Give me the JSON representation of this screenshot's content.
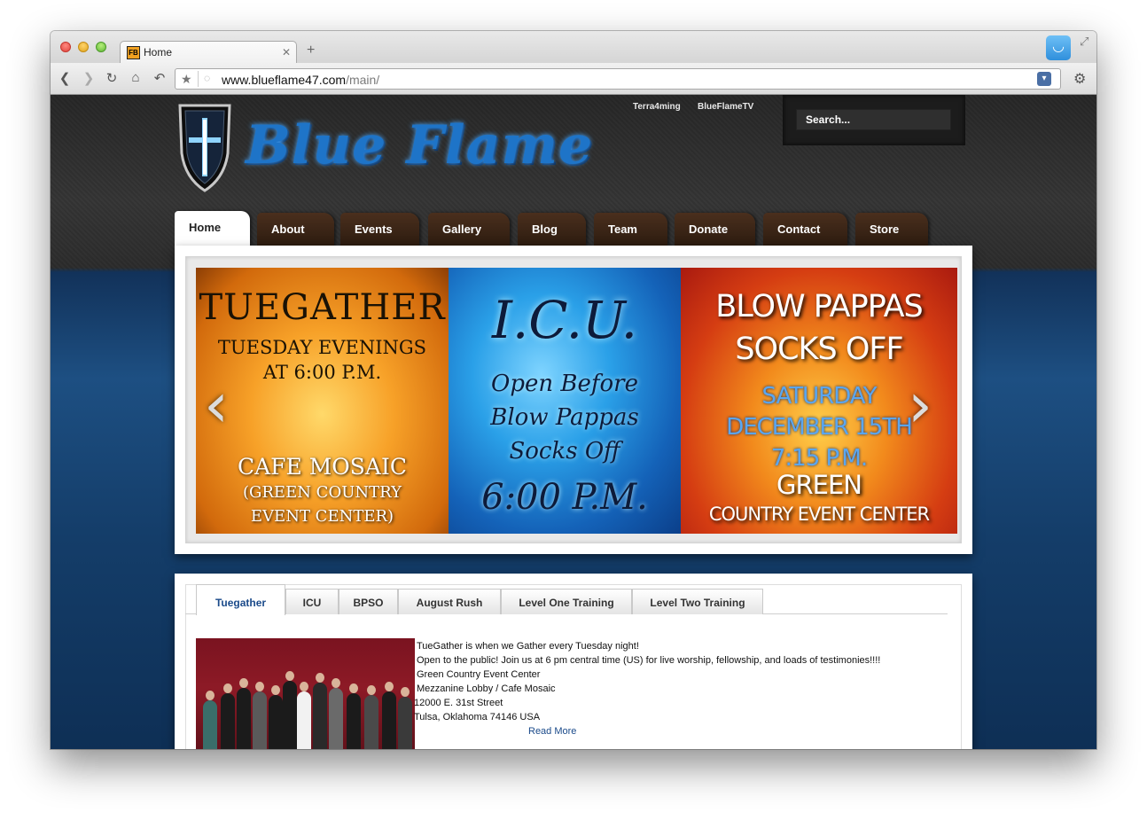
{
  "browser": {
    "tab_title": "Home",
    "tab_favicon": "FB",
    "url_host": "www.blueflame47.com",
    "url_path": "/main/",
    "icons": [
      "back-icon",
      "forward-icon",
      "reload-icon",
      "home-icon",
      "undo-icon",
      "star-icon",
      "wrench-icon"
    ]
  },
  "header": {
    "logo_text": "Blue Flame",
    "top_links": [
      "Terra4ming",
      "BlueFlameTV"
    ],
    "search_placeholder": "Search..."
  },
  "nav": {
    "items": [
      "Home",
      "About",
      "Events",
      "Gallery",
      "Blog",
      "Team",
      "Donate",
      "Contact",
      "Store"
    ],
    "active": "Home"
  },
  "slider": {
    "slide1": {
      "title": "Tuegather",
      "line1": "Tuesday evenings",
      "line2": "at 6:00 P.M.",
      "venue1": "Cafe Mosaic",
      "venue2": "(Green Country",
      "venue3": "event center)"
    },
    "slide2": {
      "title": "I.C.U.",
      "line1": "Open Before",
      "line2": "Blow Pappas",
      "line3": "Socks Off",
      "time": "6:00 P.M."
    },
    "slide3": {
      "title1": "BLOW PAPPAS",
      "title2": "SOCKS OFF",
      "date1": "SATURDAY",
      "date2": "DECEMBER 15TH",
      "date3": "7:15 P.M.",
      "venue1": "GREEN",
      "venue2": "COUNTRY EVENT CENTER"
    },
    "prev_arrow": "‹",
    "next_arrow": "›"
  },
  "content": {
    "tabs": [
      "Tuegather",
      "ICU",
      "BPSO",
      "August Rush",
      "Level One Training",
      "Level Two Training"
    ],
    "active_tab": "Tuegather",
    "description": [
      "TueGather is when we Gather every Tuesday night!",
      "Open to the public!  Join us at 6 pm central time (US) for live worship, fellowship, and loads of testimonies!!!!",
      "Green Country Event Center",
      "Mezzanine Lobby / Cafe Mosaic",
      "12000 E. 31st Street",
      "Tulsa, Oklahoma 74146 USA"
    ],
    "read_more": "Read More"
  }
}
